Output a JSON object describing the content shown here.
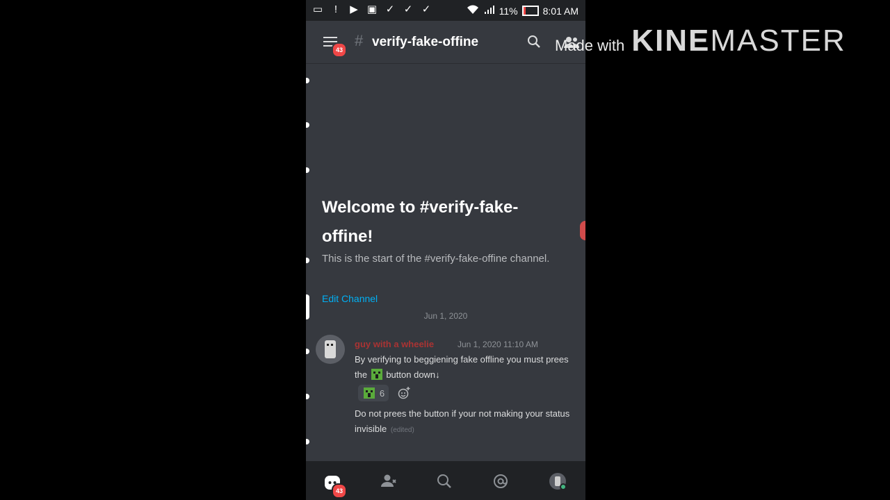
{
  "status_bar": {
    "battery": "11%",
    "time": "8:01 AM",
    "left_icons": [
      "chat-bubble-icon",
      "alert-icon",
      "video-icon",
      "image-icon",
      "check-icon",
      "check-icon",
      "check-icon"
    ],
    "right_icons": [
      "wifi-icon",
      "signal-icon",
      "battery-icon"
    ]
  },
  "top_bar": {
    "menu_badge": "43",
    "channel_hash": "#",
    "channel_name": "verify-fake-offine",
    "icons": [
      "search-icon",
      "members-icon"
    ]
  },
  "welcome": {
    "title": "Welcome to #verify-fake-offine!",
    "subtitle": "This is the start of the #verify-fake-offine channel.",
    "edit_channel": "Edit Channel"
  },
  "date_divider": "Jun 1, 2020",
  "message": {
    "author": "guy with a wheelie",
    "timestamp": "Jun 1, 2020 11:10 AM",
    "text_before_emoji": "By verifying to beggiening fake offline you must prees the",
    "text_after_emoji": "button down↓",
    "reaction_count": "6",
    "second_text": "Do not prees the button if your not making your status invisible",
    "edited_label": "(edited)"
  },
  "bottom_nav": {
    "items": [
      "home-icon",
      "friends-icon",
      "search-icon",
      "mentions-icon",
      "profile-icon"
    ],
    "home_badge": "43"
  },
  "watermark": {
    "prefix": "Made with",
    "brand_part1": "KINE",
    "brand_part2": "MASTER"
  },
  "colors": {
    "background": "#36393f",
    "nav": "#202225",
    "link": "#00b0f4",
    "badge": "#f04747",
    "author": "#aa3333"
  }
}
